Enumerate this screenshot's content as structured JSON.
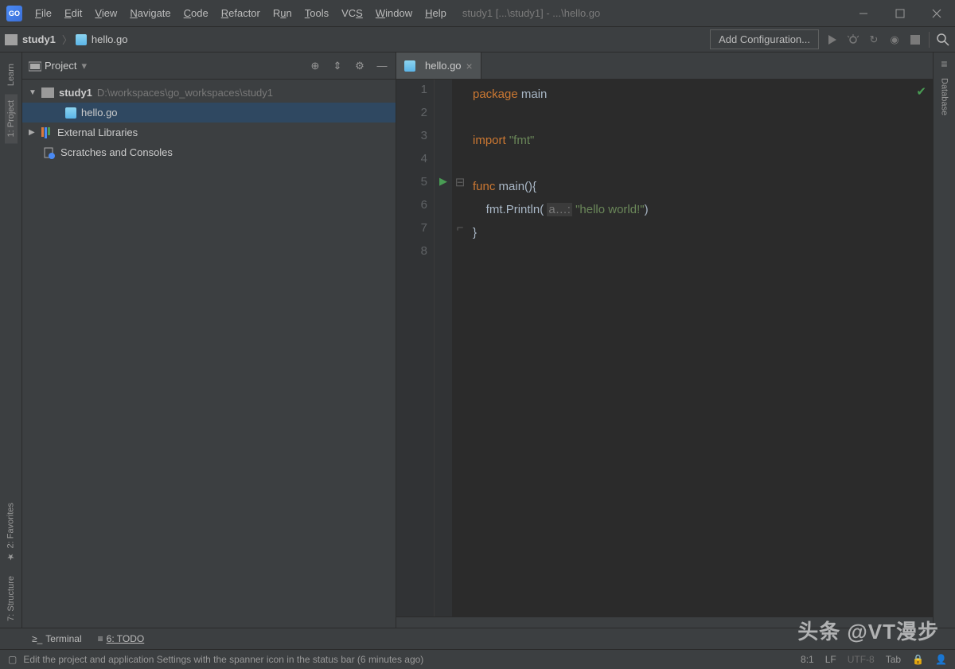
{
  "window": {
    "title": "study1 [...\\study1] - ...\\hello.go"
  },
  "menu": [
    "File",
    "Edit",
    "View",
    "Navigate",
    "Code",
    "Refactor",
    "Run",
    "Tools",
    "VCS",
    "Window",
    "Help"
  ],
  "toolbar": {
    "breadcrumb_root": "study1",
    "breadcrumb_file": "hello.go",
    "config_button": "Add Configuration..."
  },
  "left_rail": {
    "learn": "Learn",
    "project": "1: Project",
    "favorites": "2: Favorites",
    "structure": "7: Structure"
  },
  "right_rail": {
    "database": "Database"
  },
  "project_panel": {
    "title": "Project",
    "root": "study1",
    "root_path": "D:\\workspaces\\go_workspaces\\study1",
    "file": "hello.go",
    "external": "External Libraries",
    "scratches": "Scratches and Consoles"
  },
  "editor": {
    "tab_label": "hello.go",
    "code": {
      "l1_kw": "package",
      "l1_id": "main",
      "l3_kw": "import",
      "l3_str": "\"fmt\"",
      "l5_kw": "func",
      "l5_name": "main",
      "l5_rest": "(){",
      "l6_pkg": "fmt",
      "l6_dot": ".",
      "l6_fn": "Println",
      "l6_open": "( ",
      "l6_hint": "a…:",
      "l6_str": "\"hello world!\"",
      "l6_close": ")",
      "l7": "}"
    },
    "line_numbers": [
      "1",
      "2",
      "3",
      "4",
      "5",
      "6",
      "7",
      "8"
    ]
  },
  "bottom_tabs": {
    "terminal": "Terminal",
    "todo": "6: TODO"
  },
  "watermark": "头条 @VT漫步",
  "status": {
    "message": "Edit the project and application Settings with the spanner icon in the status bar (6 minutes ago)",
    "pos": "8:1",
    "lf": "LF",
    "enc": "UTF-8",
    "indent": "Tab"
  }
}
